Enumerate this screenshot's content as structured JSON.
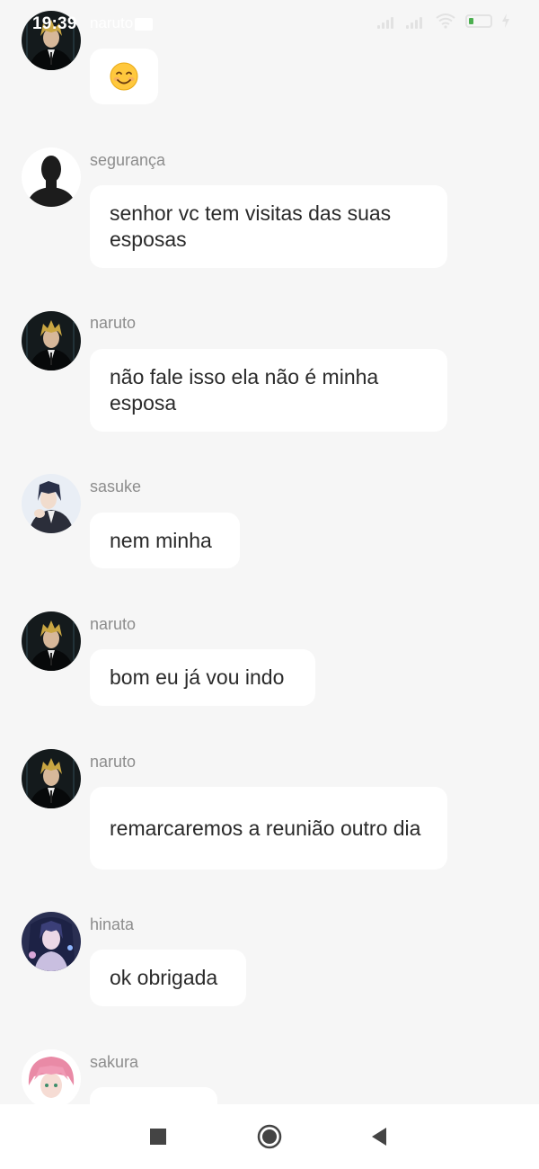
{
  "status_bar": {
    "time": "19:39",
    "overlap_text": "naruto"
  },
  "chat": {
    "messages": [
      {
        "sender": "",
        "avatar": "naruto-avatar",
        "text": "",
        "emoji": "smiling-face"
      },
      {
        "sender": "segurança",
        "avatar": "silhouette-avatar",
        "text": "senhor vc tem visitas das suas esposas"
      },
      {
        "sender": "naruto",
        "avatar": "naruto-avatar",
        "text": "não fale isso ela não é minha esposa"
      },
      {
        "sender": "sasuke",
        "avatar": "sasuke-avatar",
        "text": "nem minha"
      },
      {
        "sender": "naruto",
        "avatar": "naruto-avatar",
        "text": "bom eu já vou indo"
      },
      {
        "sender": "naruto",
        "avatar": "naruto-avatar",
        "text": "remarcaremos a reunião outro dia"
      },
      {
        "sender": "hinata",
        "avatar": "hinata-avatar",
        "text": "ok obrigada"
      },
      {
        "sender": "sakura",
        "avatar": "sakura-avatar",
        "text": ""
      }
    ]
  },
  "nav_bar": {
    "buttons": [
      "recent-apps",
      "home",
      "back"
    ]
  },
  "colors": {
    "background": "#f6f6f6",
    "bubble": "#ffffff",
    "sender_text": "#8d8d8d",
    "message_text": "#2a2a2a",
    "battery_accent": "#4caf50"
  }
}
